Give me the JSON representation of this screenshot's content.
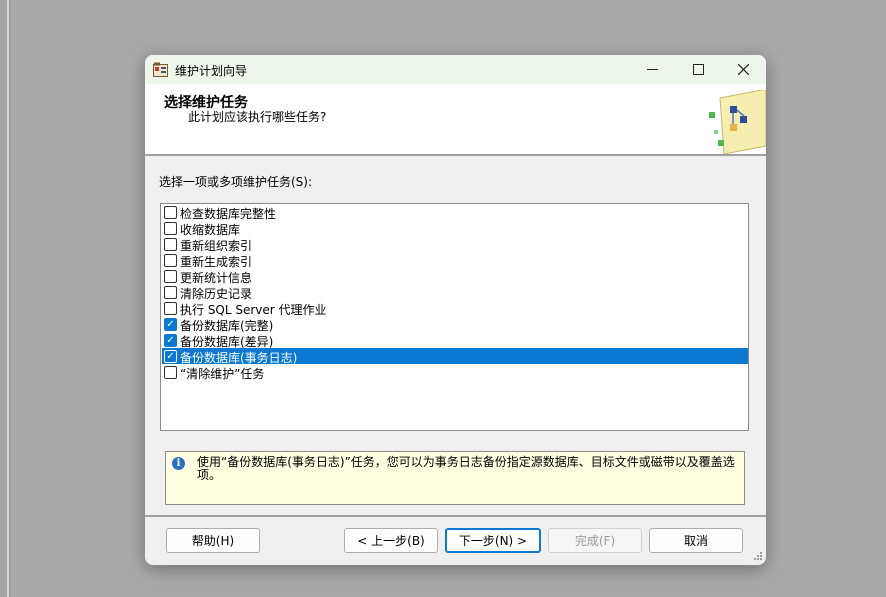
{
  "window": {
    "title": "维护计划向导"
  },
  "header": {
    "title": "选择维护任务",
    "subtitle": "此计划应该执行哪些任务?"
  },
  "list_label": "选择一项或多项维护任务(S):",
  "tasks": [
    {
      "label": "检查数据库完整性",
      "checked": false
    },
    {
      "label": "收缩数据库",
      "checked": false
    },
    {
      "label": "重新组织索引",
      "checked": false
    },
    {
      "label": "重新生成索引",
      "checked": false
    },
    {
      "label": "更新统计信息",
      "checked": false
    },
    {
      "label": "清除历史记录",
      "checked": false
    },
    {
      "label": "执行 SQL Server 代理作业",
      "checked": false
    },
    {
      "label": "备份数据库(完整)",
      "checked": true
    },
    {
      "label": "备份数据库(差异)",
      "checked": true
    },
    {
      "label": "备份数据库(事务日志)",
      "checked": true,
      "selected": true
    },
    {
      "label": "“清除维护”任务",
      "checked": false
    }
  ],
  "info_text": "使用“备份数据库(事务日志)”任务，您可以为事务日志备份指定源数据库、目标文件或磁带以及覆盖选项。",
  "buttons": {
    "help": "帮助(H)",
    "back": "< 上一步(B)",
    "next": "下一步(N) >",
    "finish": "完成(F)",
    "cancel": "取消"
  },
  "colors": {
    "accent": "#0b78d1",
    "info_bg": "#ffffe1",
    "titlebar_bg": "#eef6ec"
  }
}
